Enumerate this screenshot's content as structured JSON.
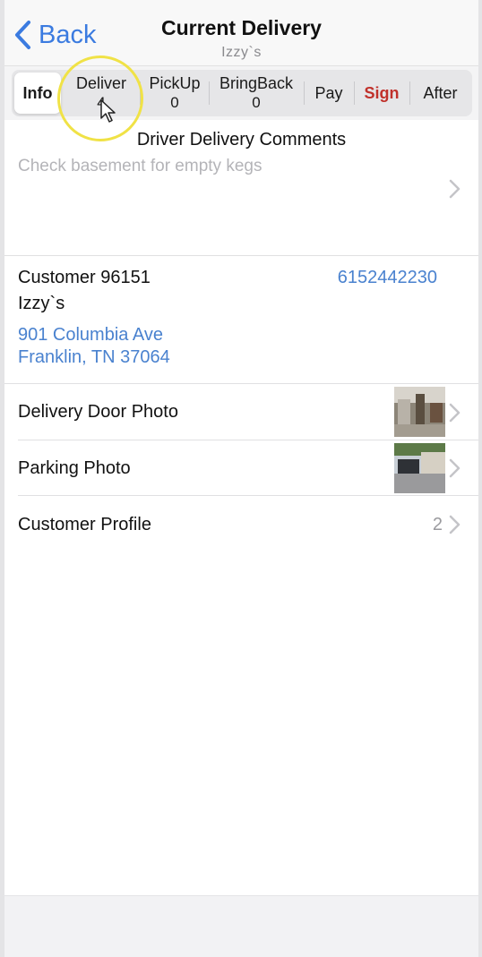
{
  "nav": {
    "back_label": "Back",
    "title": "Current Delivery",
    "subtitle": "Izzy`s"
  },
  "tabs": [
    {
      "label": "Info",
      "count": ""
    },
    {
      "label": "Deliver",
      "count": "4"
    },
    {
      "label": "PickUp",
      "count": "0"
    },
    {
      "label": "BringBack",
      "count": "0"
    },
    {
      "label": "Pay",
      "count": ""
    },
    {
      "label": "Sign",
      "count": ""
    },
    {
      "label": "After",
      "count": ""
    }
  ],
  "comments": {
    "title": "Driver Delivery Comments",
    "text": "Check basement for empty kegs"
  },
  "customer": {
    "id_label": "Customer 96151",
    "phone": "6152442230",
    "name": "Izzy`s",
    "address_line1": "901 Columbia Ave",
    "address_line2": "Franklin, TN 37064"
  },
  "rows": {
    "door_photo": "Delivery Door Photo",
    "parking_photo": "Parking Photo",
    "customer_profile": "Customer Profile",
    "profile_count": "2"
  },
  "colors": {
    "link_blue": "#4a82cf",
    "sign_red": "#c0312b",
    "highlight": "#f0e246"
  },
  "icons": [
    "chevron-left-icon",
    "chevron-right-icon",
    "cursor-icon"
  ]
}
